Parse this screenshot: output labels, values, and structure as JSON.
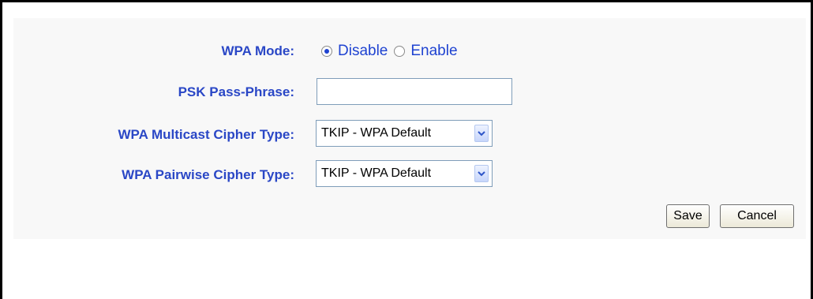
{
  "wpa_mode": {
    "label": "WPA Mode:",
    "options": [
      {
        "label": "Disable",
        "selected": true
      },
      {
        "label": "Enable",
        "selected": false
      }
    ]
  },
  "psk_pass_phrase": {
    "label": "PSK Pass-Phrase:",
    "value": "",
    "placeholder": ""
  },
  "multicast_cipher": {
    "label": "WPA Multicast Cipher Type:",
    "selected": "TKIP - WPA Default"
  },
  "pairwise_cipher": {
    "label": "WPA Pairwise Cipher Type:",
    "selected": "TKIP - WPA Default"
  },
  "actions": {
    "save": "Save",
    "cancel": "Cancel"
  },
  "colors": {
    "label_text": "#2a47c6",
    "option_text": "#1f43d1",
    "panel_background": "#f8f8f8"
  },
  "icons": {
    "dropdown": "chevron-down-icon",
    "radio": "radio-button-icon"
  }
}
